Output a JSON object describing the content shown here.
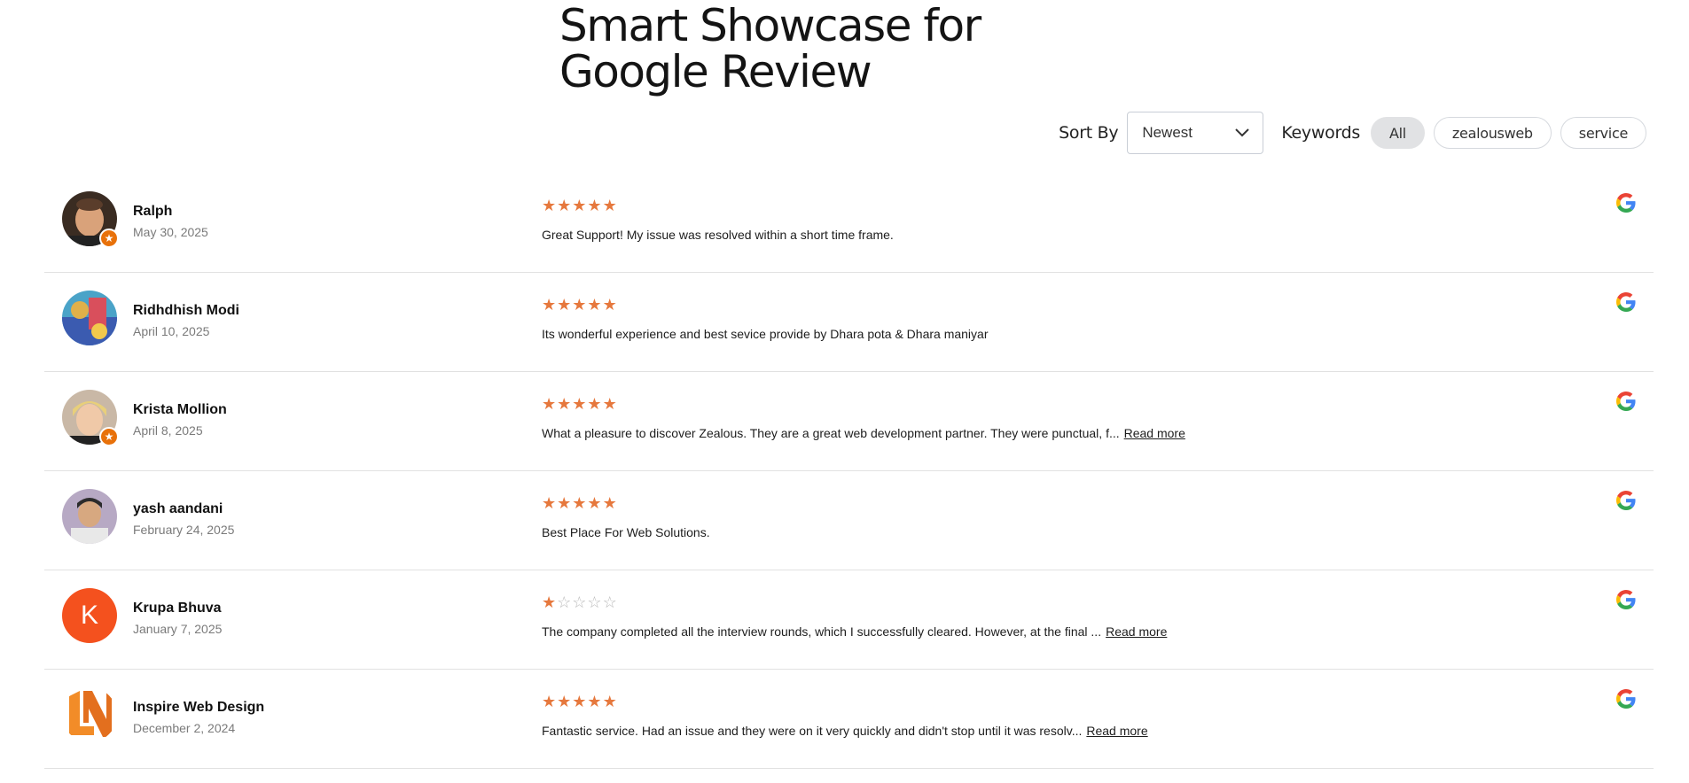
{
  "header": {
    "title_line1": "Smart Showcase for",
    "title_line2": "Google Review"
  },
  "filters": {
    "sort_label": "Sort By",
    "sort_selected": "Newest",
    "keywords_label": "Keywords",
    "chips": [
      "All",
      "zealousweb",
      "service"
    ],
    "active_chip": "All"
  },
  "colors": {
    "star": "#e6783d",
    "star_empty": "#b9b9b9",
    "badge": "#e8710a",
    "letter_avatar": "#f4511e"
  },
  "reviews": [
    {
      "name": "Ralph",
      "date": "May 30, 2025",
      "rating": 5,
      "text": "Great Support! My issue was resolved within a short time frame.",
      "read_more": "",
      "avatar": "photo",
      "local_guide": true,
      "source_icon": "google-icon"
    },
    {
      "name": "Ridhdhish Modi",
      "date": "April 10, 2025",
      "rating": 5,
      "text": "Its wonderful experience and best sevice provide by Dhara pota & Dhara maniyar",
      "read_more": "",
      "avatar": "photo",
      "local_guide": false,
      "source_icon": "google-icon"
    },
    {
      "name": "Krista Mollion",
      "date": "April 8, 2025",
      "rating": 5,
      "text": "What a pleasure to discover Zealous. They are a great web development partner. They were punctual, f...",
      "read_more": "Read more",
      "avatar": "photo",
      "local_guide": true,
      "source_icon": "google-icon"
    },
    {
      "name": "yash aandani",
      "date": "February 24, 2025",
      "rating": 5,
      "text": "Best Place For Web Solutions.",
      "read_more": "",
      "avatar": "photo",
      "local_guide": false,
      "source_icon": "google-icon"
    },
    {
      "name": "Krupa Bhuva",
      "date": "January 7, 2025",
      "rating": 1,
      "text": "The company completed all the interview rounds, which I successfully cleared. However, at the final ...",
      "read_more": "Read more",
      "avatar": "K",
      "local_guide": false,
      "source_icon": "google-icon"
    },
    {
      "name": "Inspire Web Design",
      "date": "December 2, 2024",
      "rating": 5,
      "text": "Fantastic service. Had an issue and they were on it very quickly and didn't stop until it was resolv...",
      "read_more": "Read more",
      "avatar": "logo",
      "local_guide": false,
      "source_icon": "google-icon"
    }
  ]
}
